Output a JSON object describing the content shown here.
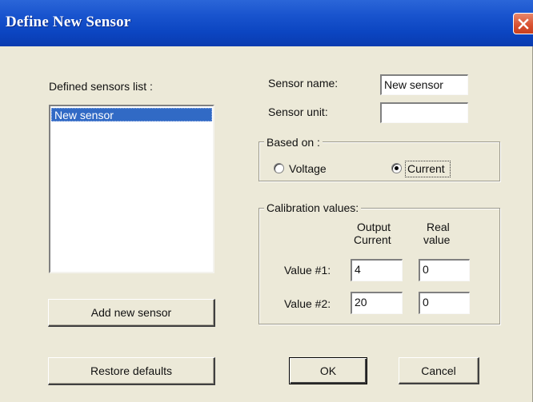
{
  "window": {
    "title": "Define New Sensor",
    "close_icon": "close-icon"
  },
  "sensors_list": {
    "label": "Defined sensors list :",
    "items": [
      "New sensor"
    ],
    "selected_index": 0
  },
  "buttons": {
    "add_new_sensor": "Add new sensor",
    "restore_defaults": "Restore defaults",
    "ok": "OK",
    "cancel": "Cancel"
  },
  "sensor_name": {
    "label": "Sensor name:",
    "value": "New sensor"
  },
  "sensor_unit": {
    "label": "Sensor unit:",
    "value": ""
  },
  "based_on": {
    "legend": "Based on :",
    "options": [
      "Voltage",
      "Current"
    ],
    "selected": "Current"
  },
  "calibration": {
    "legend": "Calibration values:",
    "col_output_line1": "Output",
    "col_output_line2": "Current",
    "col_real_line1": "Real",
    "col_real_line2": "value",
    "rows": [
      {
        "label": "Value #1:",
        "output": "4",
        "real": "0"
      },
      {
        "label": "Value #2:",
        "output": "20",
        "real": "0"
      }
    ]
  },
  "colors": {
    "titlebar": "#0b45c1",
    "dialog_bg": "#ece9d8",
    "selection": "#316ac5",
    "close_button": "#d8502f"
  }
}
